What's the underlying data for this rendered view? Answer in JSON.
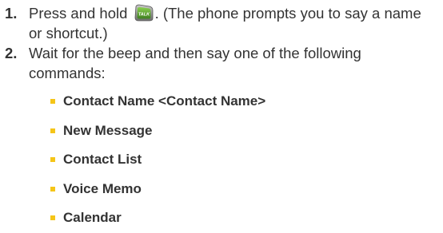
{
  "steps": [
    {
      "number": "1.",
      "text_before_icon": "Press and hold",
      "text_after_icon": ". (The phone prompts you to say a name or shortcut.)",
      "icon": "talk-key-icon",
      "icon_label": "TALK"
    },
    {
      "number": "2.",
      "text": "Wait for the beep and then say one of the following commands:"
    }
  ],
  "commands": [
    "Contact Name <Contact Name>",
    "New Message",
    "Contact List",
    "Voice Memo",
    "Calendar"
  ],
  "colors": {
    "text": "#333333",
    "bullet": "#f5c518",
    "talk_key_green": "#5a9e32"
  }
}
